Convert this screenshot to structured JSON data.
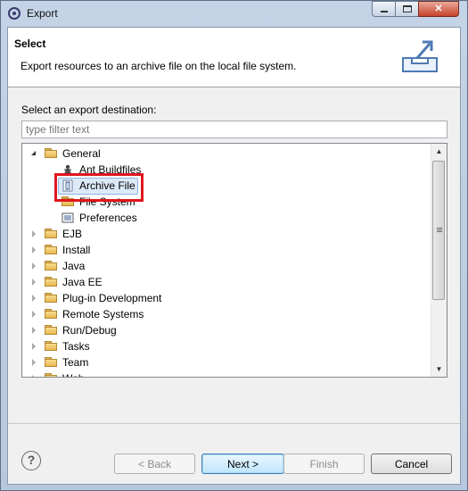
{
  "window": {
    "title": "Export"
  },
  "header": {
    "title": "Select",
    "description": "Export resources to an archive file on the local file system."
  },
  "destination_label": "Select an export destination:",
  "filter": {
    "placeholder": "type filter text",
    "value": ""
  },
  "tree": {
    "general": "General",
    "general_children": [
      "Ant Buildfiles",
      "Archive File",
      "File System",
      "Preferences"
    ],
    "selected": "Archive File",
    "categories": [
      "EJB",
      "Install",
      "Java",
      "Java EE",
      "Plug-in Development",
      "Remote Systems",
      "Run/Debug",
      "Tasks",
      "Team",
      "Web"
    ]
  },
  "buttons": {
    "help": "?",
    "back": "< Back",
    "next": "Next >",
    "finish": "Finish",
    "cancel": "Cancel"
  },
  "colors": {
    "highlight": "#e0161e",
    "accent": "#3c7fb1"
  }
}
